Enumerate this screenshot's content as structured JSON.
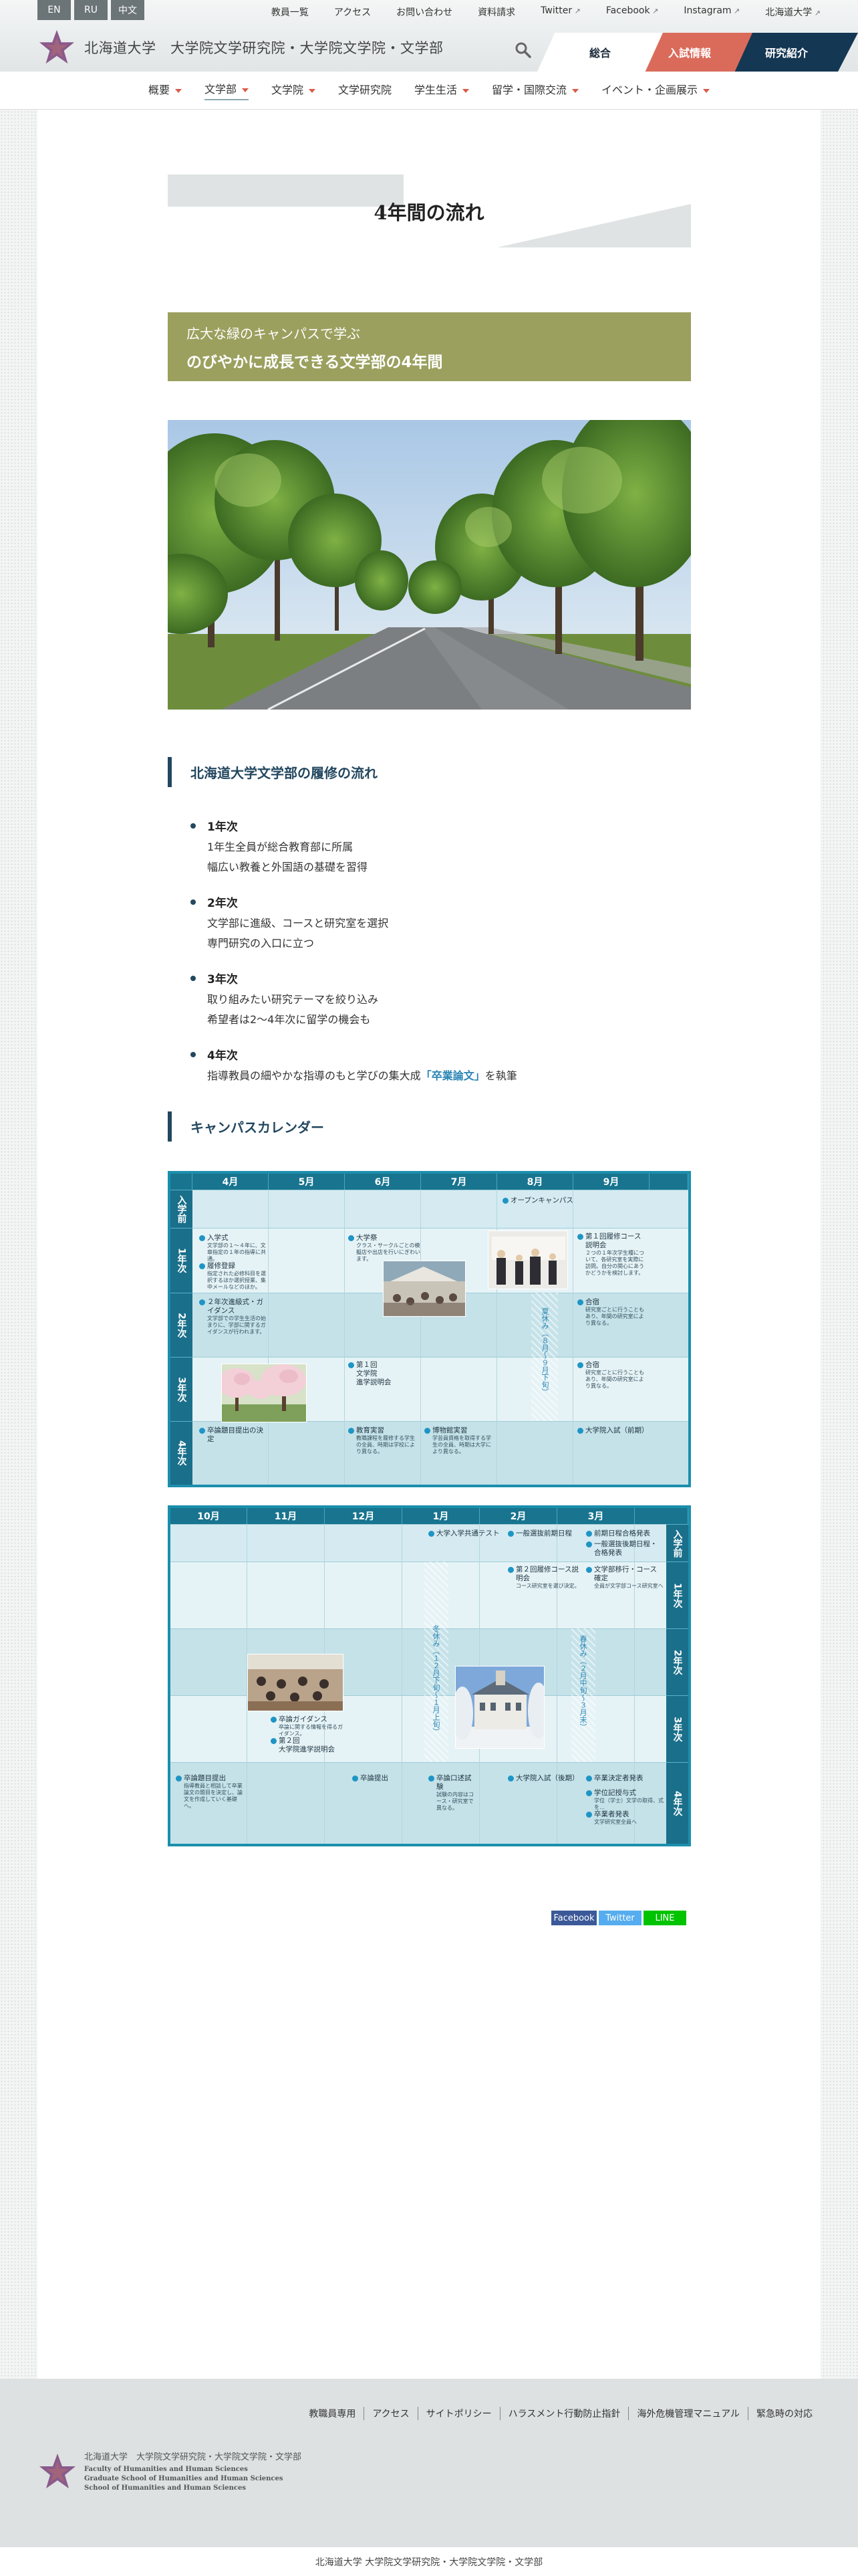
{
  "header": {
    "langs": [
      "EN",
      "RU",
      "中文"
    ],
    "utils": [
      "教員一覧",
      "アクセス",
      "お問い合わせ",
      "資料請求",
      "Twitter",
      "Facebook",
      "Instagram",
      "北海道大学"
    ],
    "logo_text": "北海道大学　大学院文学研究院・大学院文学院・文学部",
    "tabs": [
      "総合",
      "入試情報",
      "研究紹介"
    ],
    "nav": [
      {
        "label": "概要",
        "dropdown": true
      },
      {
        "label": "文学部",
        "dropdown": true
      },
      {
        "label": "文学院",
        "dropdown": true
      },
      {
        "label": "文学研究院",
        "dropdown": false
      },
      {
        "label": "学生生活",
        "dropdown": true
      },
      {
        "label": "留学・国際交流",
        "dropdown": true
      },
      {
        "label": "イベント・企画展示",
        "dropdown": true
      }
    ]
  },
  "page": {
    "title": "4年間の流れ",
    "banner_sub": "広大な緑のキャンパスで学ぶ",
    "banner_main": "のびやかに成長できる文学部の4年間",
    "section1": "北海道大学文学部の履修の流れ",
    "years": [
      {
        "t": "1年次",
        "l1": "1年生全員が総合教育部に所属",
        "l2": "幅広い教養と外国語の基礎を習得"
      },
      {
        "t": "2年次",
        "l1": "文学部に進級、コースと研究室を選択",
        "l2": "専門研究の入口に立つ"
      },
      {
        "t": "3年次",
        "l1": "取り組みたい研究テーマを絞り込み",
        "l2": "希望者は2〜4年次に留学の機会も"
      },
      {
        "t": "4年次",
        "l1": "指導教員の細やかな指導のもと学びの集大成",
        "hl": "「卒業論文」",
        "l2end": "を執筆"
      }
    ],
    "section2": "キャンパスカレンダー"
  },
  "calendar1": {
    "months": [
      "4月",
      "5月",
      "6月",
      "7月",
      "8月",
      "9月"
    ],
    "rows": [
      "入学前",
      "1年次",
      "2年次",
      "3年次",
      "4年次"
    ],
    "events": {
      "open_campus": "オープンキャンパス",
      "entrance": "入学式",
      "entrance_sm": "文学部の１〜４年に、文章指定の１年の指導に共通。",
      "course_reg": "履修登録",
      "course_reg_sm": "指定された必修科目を選択するほか選択授業、集中メールなどのほか。",
      "festival": "大学祭",
      "festival_sm": "クラス・サークルごとの模擬店や出店を行いにぎわいます。",
      "first_course": "第１回履修コース説明会",
      "first_course_sm": "２つの１年次学生種について、各研究室を実際に訪問。自分の関心にあうかどうかを検討します。",
      "grade2": "２年次進級式・ガイダンス",
      "grade2_sm": "文学部での学生生活の始まりに、学部に関するガイダンスが行われます。",
      "seminar": "合宿",
      "seminar_sm": "研究室ごとに行うこともあり、年間の研究室により異なる。",
      "summer": "夏休み（８月〜９月下旬）",
      "entry1": "第１回",
      "entry1b": "文学院",
      "entry1c": "進学説明会",
      "seminar2": "合宿",
      "seminar2_sm": "研究室ごとに行うこともあり、年間の研究室により異なる。",
      "thesis_plan": "卒論題目提出の決定",
      "practice": "教育実習",
      "practice_sm": "教職課程を履修する学生の全員、時期は学校により異なる。",
      "museum": "博物館実習",
      "museum_sm": "学芸員資格を取得する学生の全員、時期は大学により異なる。",
      "grad_exam": "大学院入試（前期）"
    }
  },
  "calendar2": {
    "months": [
      "10月",
      "11月",
      "12月",
      "1月",
      "2月",
      "3月"
    ],
    "rows": [
      "入学前",
      "1年次",
      "2年次",
      "3年次",
      "4年次"
    ],
    "events": {
      "common_test": "大学入学共通テスト",
      "general1": "一般選抜前期日程",
      "general2": "前期日程合格発表",
      "general3": "一般選抜後期日程・合格発表",
      "second_course": "第２回履修コース説明会",
      "second_course_sm": "コース研究室を選び決定。",
      "transfer": "文学部移行・コース確定",
      "transfer_sm": "全員が文学部コース研究室へ",
      "winter": "冬休み（１２月下旬〜１月上旬）",
      "spring": "春休み（２月中旬〜３月末）",
      "research_guidance": "卒論ガイダンス",
      "research_guidance_sm": "卒論に関する情報を得るガイダンス。",
      "entry2": "第２回",
      "entry2b": "大学院進学説明会",
      "thesis_title": "卒論題目提出",
      "thesis_title_sm": "指導教員と相談して卒業論文の題目を決定し、論文を作成していく基礎へ。",
      "thesis_sub": "卒論提出",
      "oral": "卒論口述試験",
      "oral_sm": "試験の内容はコース・研究室で異なる。",
      "grad_exam2": "大学院入試（後期）",
      "grad_ann": "卒業決定者発表",
      "grad_ceremony": "学位記授与式",
      "grad_ceremony_sm": "学位（学士）文学の取得、式を…",
      "grad_ann2": "卒業者発表",
      "grad_ann2_sm": "文学研究室全員へ"
    }
  },
  "share": [
    "Facebook",
    "Twitter",
    "LINE"
  ],
  "footer": {
    "links": [
      "教職員専用",
      "アクセス",
      "サイトポリシー",
      "ハラスメント行動防止指針",
      "海外危機管理マニュアル",
      "緊急時の対応"
    ],
    "logo_ja": "北海道大学　大学院文学研究院・大学院文学院・文学部",
    "logo_en1": "Faculty of Humanities and Human Sciences",
    "logo_en2": "Graduate School of Humanities and Human Sciences",
    "logo_en3": "School of Humanities and Human Sciences",
    "copyright": "北海道大学 大学院文学研究院・大学院文学院・文学部"
  },
  "colors": {
    "navy": "#143753",
    "coral": "#da6b5b",
    "olive": "#9ba05e",
    "teal": "#1b8fad"
  }
}
